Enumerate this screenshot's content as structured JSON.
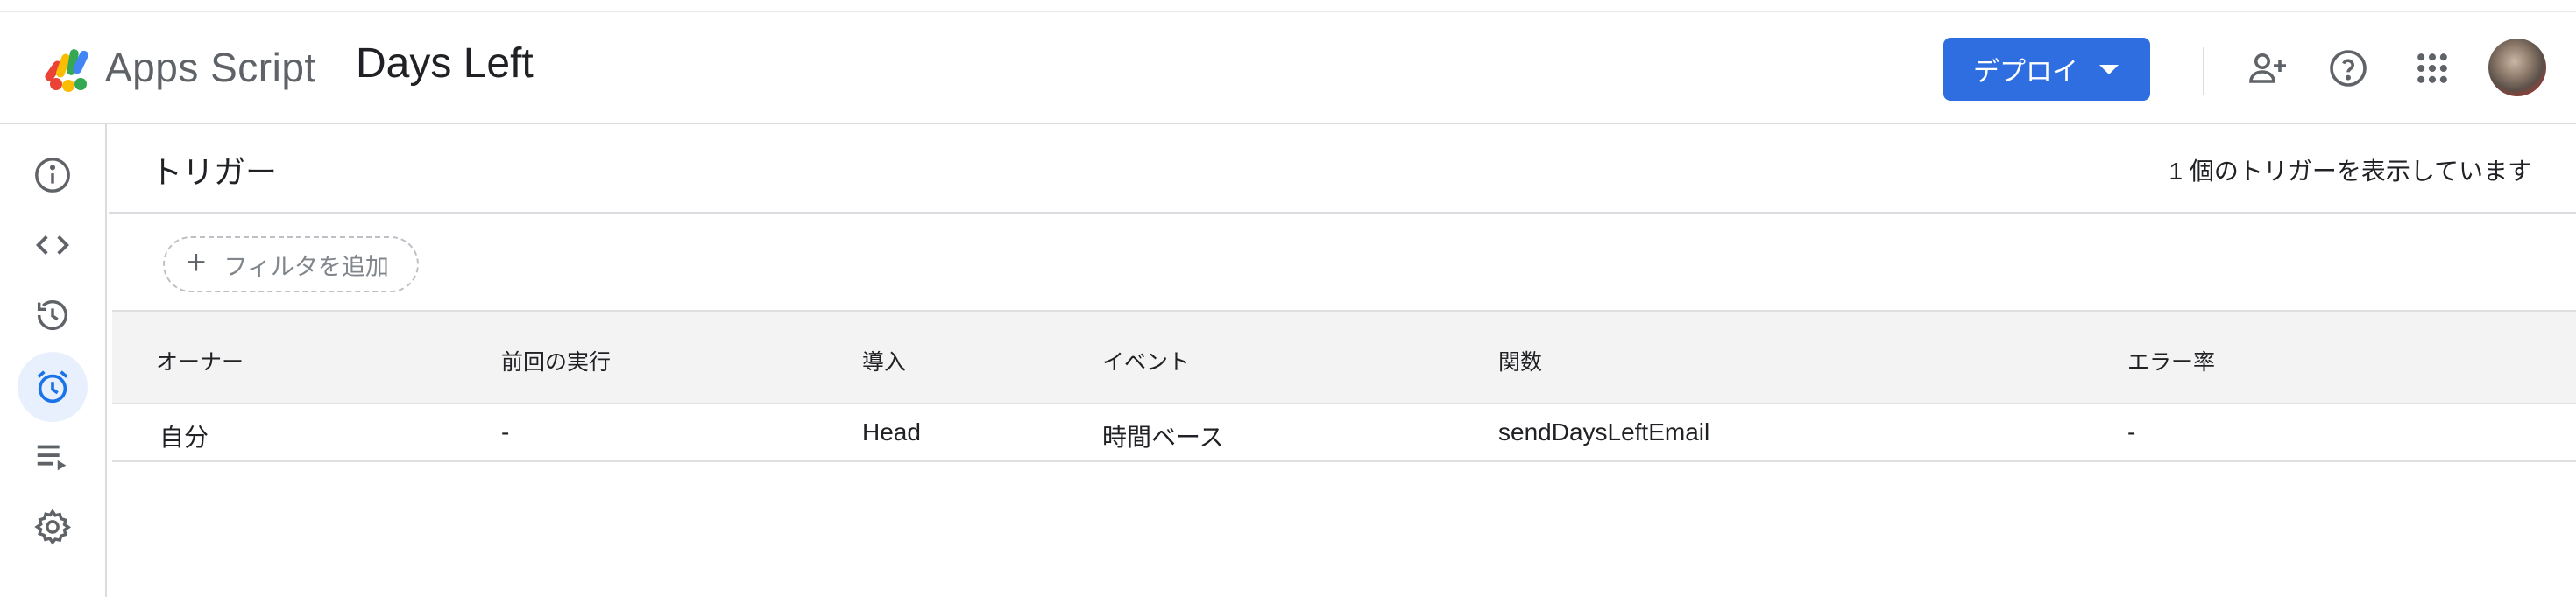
{
  "header": {
    "brand": "Apps Script",
    "project_title": "Days Left",
    "deploy_label": "デプロイ",
    "icons": [
      "logo-icon",
      "add-person-icon",
      "help-icon",
      "apps-grid-icon",
      "avatar"
    ]
  },
  "sidebar": {
    "items": [
      {
        "name": "overview",
        "icon": "info-icon"
      },
      {
        "name": "editor",
        "icon": "code-icon"
      },
      {
        "name": "executions",
        "icon": "history-icon"
      },
      {
        "name": "triggers",
        "icon": "alarm-clock-icon",
        "active": true
      },
      {
        "name": "executions-list",
        "icon": "playlist-icon"
      },
      {
        "name": "settings",
        "icon": "gear-icon"
      }
    ]
  },
  "page": {
    "title": "トリガー",
    "count_text": "1 個のトリガーを表示しています",
    "filter_label": "フィルタを追加"
  },
  "table": {
    "columns": [
      "オーナー",
      "前回の実行",
      "導入",
      "イベント",
      "関数",
      "エラー率"
    ],
    "rows": [
      [
        "自分",
        "-",
        "Head",
        "時間ベース",
        "sendDaysLeftEmail",
        "-"
      ]
    ]
  },
  "colors": {
    "accent": "#2f6ee0",
    "active_nav_bg": "#e8f0fe",
    "active_nav_icon": "#1a73e8",
    "icon_gray": "#5f6368",
    "table_header_bg": "#f3f3f3"
  }
}
